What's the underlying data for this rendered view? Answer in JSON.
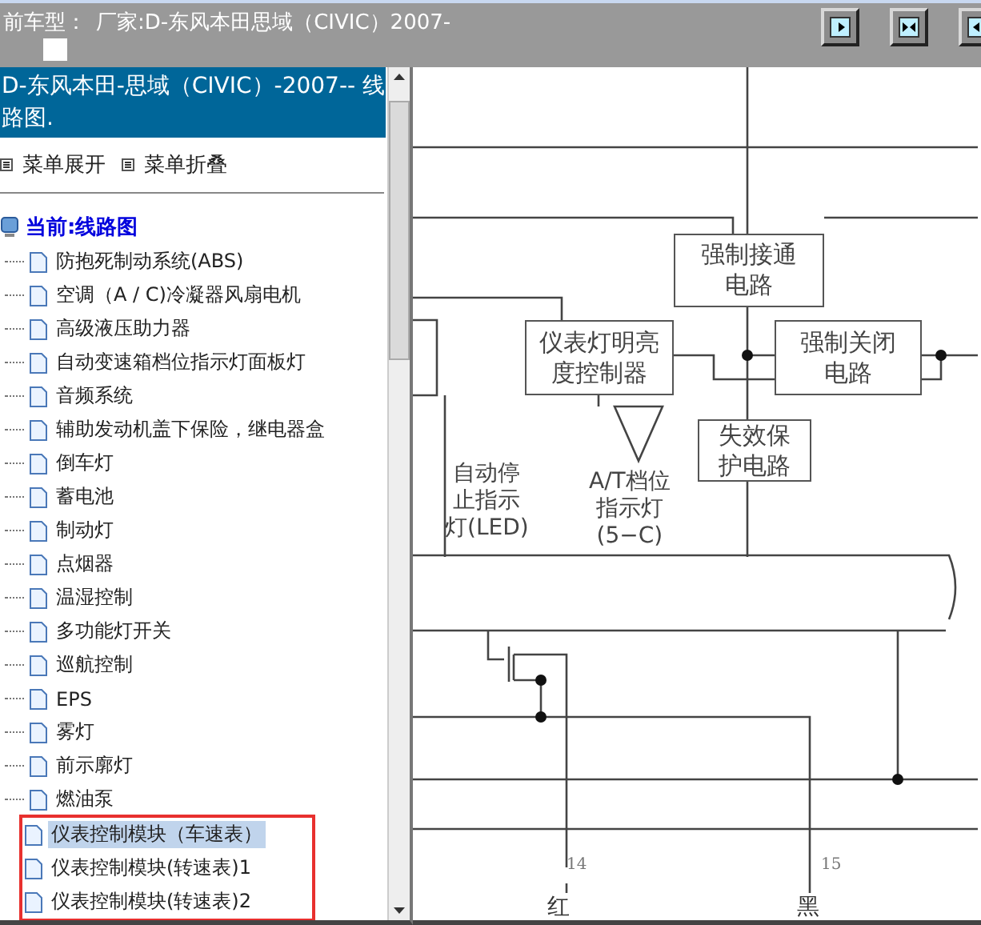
{
  "top_bar": {
    "vehicle_label": "前车型：",
    "vehicle_value": "厂家:D-东风本田思域（CIVIC）2007-",
    "buttons": [
      {
        "kind": "right"
      },
      {
        "kind": "both"
      },
      {
        "kind": "left"
      }
    ]
  },
  "sidebar": {
    "header": "D-东风本田-思域（CIVIC）-2007-- 线路图.",
    "menu_actions": [
      "菜单展开",
      "菜单折叠"
    ],
    "tree": {
      "label": "当前:线路图",
      "children": [
        {
          "label": "防抱死制动系统(ABS)",
          "selected": false,
          "annotated": false
        },
        {
          "label": "空调（A / C)冷凝器风扇电机",
          "selected": false,
          "annotated": false
        },
        {
          "label": "高级液压助力器",
          "selected": false,
          "annotated": false
        },
        {
          "label": "自动变速箱档位指示灯面板灯",
          "selected": false,
          "annotated": false
        },
        {
          "label": "音频系统",
          "selected": false,
          "annotated": false
        },
        {
          "label": "辅助发动机盖下保险，继电器盒",
          "selected": false,
          "annotated": false
        },
        {
          "label": "倒车灯",
          "selected": false,
          "annotated": false
        },
        {
          "label": "蓄电池",
          "selected": false,
          "annotated": false
        },
        {
          "label": "制动灯",
          "selected": false,
          "annotated": false
        },
        {
          "label": "点烟器",
          "selected": false,
          "annotated": false
        },
        {
          "label": "温湿控制",
          "selected": false,
          "annotated": false
        },
        {
          "label": "多功能灯开关",
          "selected": false,
          "annotated": false
        },
        {
          "label": "巡航控制",
          "selected": false,
          "annotated": false
        },
        {
          "label": "EPS",
          "selected": false,
          "annotated": false
        },
        {
          "label": "雾灯",
          "selected": false,
          "annotated": false
        },
        {
          "label": "前示廓灯",
          "selected": false,
          "annotated": false
        },
        {
          "label": "燃油泵",
          "selected": false,
          "annotated": false
        },
        {
          "label": "仪表控制模块（车速表）",
          "selected": true,
          "annotated": true
        },
        {
          "label": "仪表控制模块(转速表)1",
          "selected": false,
          "annotated": true
        },
        {
          "label": "仪表控制模块(转速表)2",
          "selected": false,
          "annotated": true
        }
      ]
    }
  },
  "diagram": {
    "boxes": [
      {
        "lines": [
          "强制接通",
          "电路"
        ]
      },
      {
        "lines": [
          "仪表灯明亮",
          "度控制器"
        ]
      },
      {
        "lines": [
          "强制关闭",
          "电路"
        ]
      },
      {
        "lines": [
          "失效保",
          "护电路"
        ]
      }
    ],
    "labels": [
      {
        "lines": [
          "自动停",
          "止指示",
          "灯(LED)"
        ]
      },
      {
        "lines": [
          "A/T档位",
          "指示灯",
          "(5−C)"
        ]
      }
    ],
    "pins": [
      "14",
      "15"
    ],
    "wire_colors": [
      "红",
      "黑"
    ]
  }
}
